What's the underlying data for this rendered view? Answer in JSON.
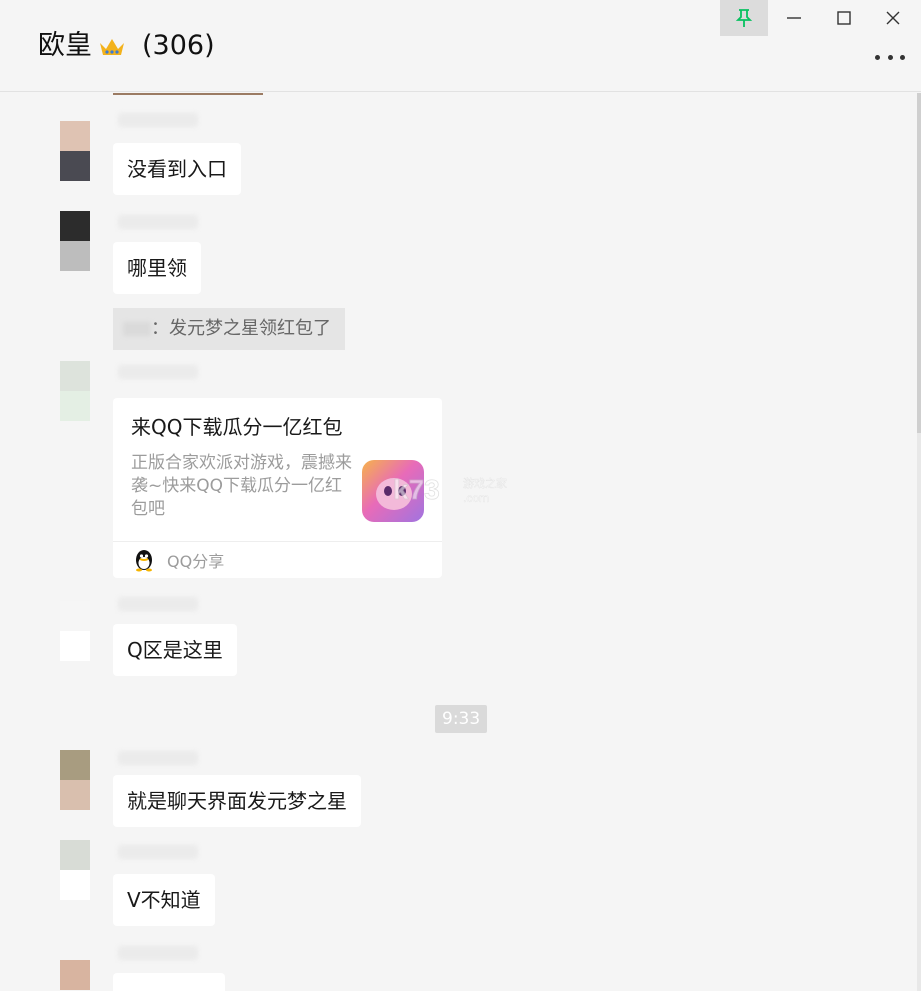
{
  "window": {
    "title": "欧皇",
    "member_count": "(306)",
    "pin_icon": "pin-icon",
    "minimize_icon": "minimize-icon",
    "maximize_icon": "maximize-icon",
    "close_icon": "close-icon",
    "more_icon": "more-icon"
  },
  "messages": {
    "m1": "没看到入口",
    "m2": "哪里领",
    "system_text": "：发元梦之星领红包了",
    "m4": "Q区是这里",
    "time": "9:33",
    "m5": "就是聊天界面发元梦之星",
    "m6": "V不知道"
  },
  "card": {
    "title": "来QQ下载瓜分一亿红包",
    "description": "正版合家欢派对游戏，震撼来袭~快来QQ下载瓜分一亿红包吧",
    "source": "QQ分享"
  },
  "colors": {
    "background": "#f5f5f5",
    "bubble": "#ffffff",
    "system": "#e5e5e5",
    "accent_pin": "#07c160"
  }
}
